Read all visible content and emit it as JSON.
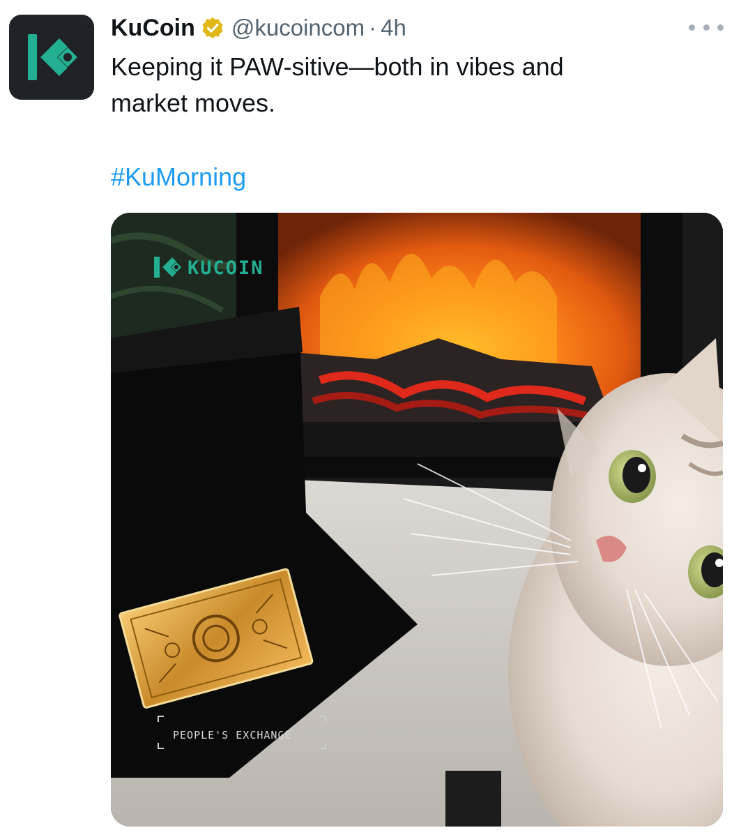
{
  "tweet": {
    "author": {
      "display_name": "KuCoin",
      "handle": "@kucoincom",
      "verified_badge": "gold-verified-badge-icon",
      "avatar": "kucoin-logo-icon"
    },
    "separator": "·",
    "time": "4h",
    "text_lines": [
      "Keeping it PAW-sitive—both in vibes and",
      "market moves."
    ],
    "hashtag": "#KuMorning",
    "more_icon": "more-dots-icon"
  },
  "media": {
    "brand_text": "KUCOIN",
    "tag_text": "PEOPLE'S EXCHANGE"
  },
  "colors": {
    "brand_green": "#23AF91",
    "link_blue": "#1D9BF0",
    "verified_gold": "#E2B719",
    "text_primary": "#0F1419",
    "text_secondary": "#536471"
  }
}
